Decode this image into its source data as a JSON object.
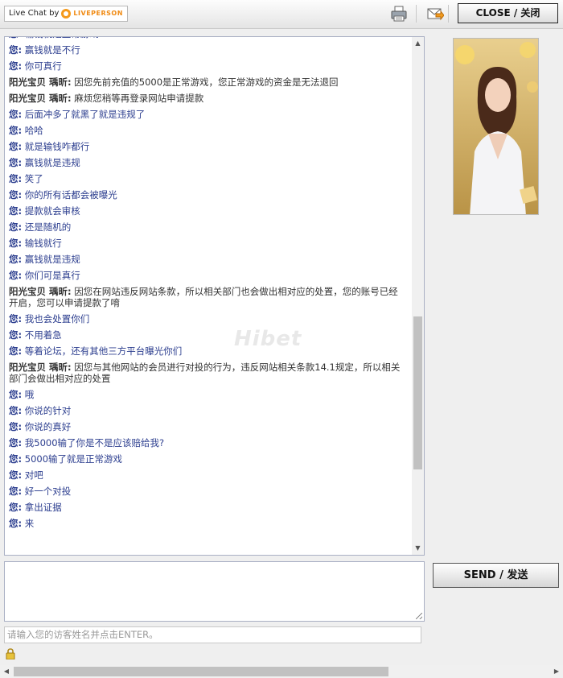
{
  "header": {
    "brand_prefix": "Live Chat by",
    "brand_name": "LIVEPERSON",
    "close_label": "CLOSE / 关闭",
    "icons": [
      "printer-icon",
      "email-transcript-icon"
    ]
  },
  "watermark": "Hibet",
  "messages": [
    {
      "sender": "您:",
      "text": "输钱就是正常游戏",
      "type": "visitor"
    },
    {
      "sender": "您:",
      "text": "赢钱就是不行",
      "type": "visitor"
    },
    {
      "sender": "您:",
      "text": "你可真行",
      "type": "visitor"
    },
    {
      "sender": "阳光宝贝 瑀昕:",
      "text": "因您先前充值的5000是正常游戏，您正常游戏的资金是无法退回",
      "type": "agent"
    },
    {
      "sender": "阳光宝贝 瑀昕:",
      "text": "麻烦您稍等再登录网站申请提款",
      "type": "agent"
    },
    {
      "sender": "您:",
      "text": "后面冲多了就黑了就是违规了",
      "type": "visitor"
    },
    {
      "sender": "您:",
      "text": "哈哈",
      "type": "visitor"
    },
    {
      "sender": "您:",
      "text": "就是输钱咋都行",
      "type": "visitor"
    },
    {
      "sender": "您:",
      "text": "赢钱就是违规",
      "type": "visitor"
    },
    {
      "sender": "您:",
      "text": "笑了",
      "type": "visitor"
    },
    {
      "sender": "您:",
      "text": "你的所有话都会被曝光",
      "type": "visitor"
    },
    {
      "sender": "您:",
      "text": "提款就会审核",
      "type": "visitor"
    },
    {
      "sender": "您:",
      "text": "还是随机的",
      "type": "visitor"
    },
    {
      "sender": "您:",
      "text": "输钱就行",
      "type": "visitor"
    },
    {
      "sender": "您:",
      "text": "赢钱就是违规",
      "type": "visitor"
    },
    {
      "sender": "您:",
      "text": "你们可是真行",
      "type": "visitor"
    },
    {
      "sender": "阳光宝贝 瑀昕:",
      "text": "因您在网站违反网站条款，所以相关部门也会做出相对应的处置，您的账号已经开启，您可以申请提款了唷",
      "type": "agent"
    },
    {
      "sender": "您:",
      "text": "我也会处置你们",
      "type": "visitor"
    },
    {
      "sender": "您:",
      "text": "不用着急",
      "type": "visitor"
    },
    {
      "sender": "您:",
      "text": "等着论坛，还有其他三方平台曝光你们",
      "type": "visitor"
    },
    {
      "sender": "阳光宝贝 瑀昕:",
      "text": "因您与其他网站的会员进行对投的行为，违反网站相关条款14.1规定，所以相关部门会做出相对应的处置",
      "type": "agent"
    },
    {
      "sender": "您:",
      "text": "哦",
      "type": "visitor"
    },
    {
      "sender": "您:",
      "text": "你说的针对",
      "type": "visitor"
    },
    {
      "sender": "您:",
      "text": "你说的真好",
      "type": "visitor"
    },
    {
      "sender": "您:",
      "text": "我5000输了你是不是应该赔给我?",
      "type": "visitor"
    },
    {
      "sender": "您:",
      "text": "5000输了就是正常游戏",
      "type": "visitor"
    },
    {
      "sender": "您:",
      "text": "对吧",
      "type": "visitor"
    },
    {
      "sender": "您:",
      "text": "好一个对投",
      "type": "visitor"
    },
    {
      "sender": "您:",
      "text": "拿出证据",
      "type": "visitor"
    },
    {
      "sender": "您:",
      "text": "来",
      "type": "visitor"
    }
  ],
  "composer": {
    "message_value": "",
    "send_label": "SEND / 发送",
    "name_placeholder": "请输入您的访客姓名并点击ENTER。"
  },
  "colors": {
    "visitor_text": "#2c3e8f",
    "agent_text": "#333333",
    "brand_accent": "#f59a1c",
    "chat_border": "#aab0c4"
  }
}
